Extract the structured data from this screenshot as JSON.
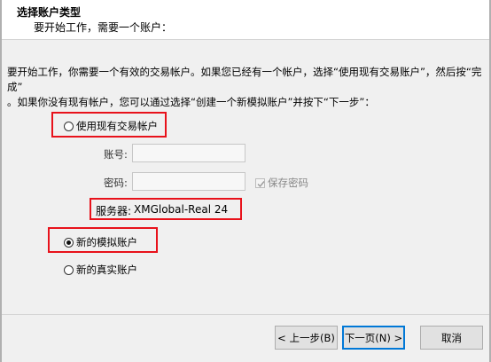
{
  "header": {
    "title": "选择账户类型",
    "subtitle": "要开始工作，需要一个账户："
  },
  "instructions": "要开始工作，你需要一个有效的交易帐户。如果您已经有一个帐户，选择“使用现有交易账户”，然后按“完成”\n。如果你没有现有帐户，您可以通过选择“创建一个新模拟账户”并按下“下一步”：",
  "options": {
    "existing_account": {
      "label": "使用现有交易帐户",
      "checked": false
    },
    "new_demo": {
      "label": "新的模拟账户",
      "checked": true
    },
    "new_real": {
      "label": "新的真实账户",
      "checked": false
    }
  },
  "fields": {
    "account_label": "账号:",
    "account_value": "",
    "password_label": "密码:",
    "password_value": "",
    "save_password_label": "保存密码",
    "save_password_checked": true
  },
  "server": {
    "label": "服务器:",
    "value": "XMGlobal-Real 24"
  },
  "buttons": {
    "back": "< 上一步(B)",
    "next": "下一页(N) >",
    "cancel": "取消"
  },
  "colors": {
    "highlight": "#e8121b",
    "dialog_bg": "#f0f0f0",
    "header_bg": "#ffffff",
    "default_button_border": "#0078d7"
  }
}
